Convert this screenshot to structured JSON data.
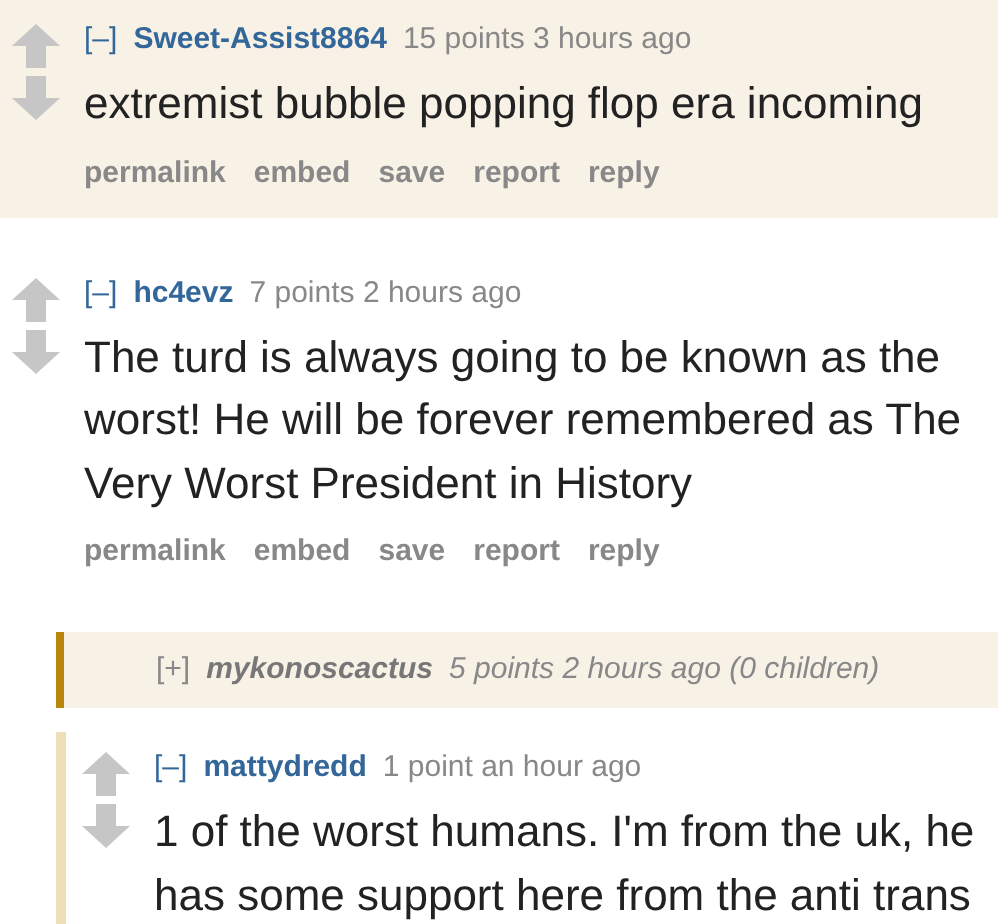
{
  "comments": [
    {
      "kind": "comment",
      "highlighted": true,
      "toggle": "[–]",
      "author": "Sweet-Assist8864",
      "tagline": "15 points 3 hours ago",
      "body": "extremist bubble popping flop era incoming",
      "actions": [
        "permalink",
        "embed",
        "save",
        "report",
        "reply"
      ]
    },
    {
      "kind": "comment",
      "highlighted": false,
      "toggle": "[–]",
      "author": "hc4evz",
      "tagline": "7 points 2 hours ago",
      "body": "The turd is always going to be known as the worst! He will be forever remembered as The Very Worst President in History",
      "actions": [
        "permalink",
        "embed",
        "save",
        "report",
        "reply"
      ],
      "children": [
        {
          "kind": "collapsed",
          "toggle": "[+]",
          "author": "mykonoscactus",
          "tagline": "5 points 2 hours ago (0 children)"
        },
        {
          "kind": "comment",
          "highlighted": false,
          "toggle": "[–]",
          "author": "mattydredd",
          "tagline": "1 point an hour ago",
          "body": "1 of the worst humans. I'm from the uk, he has some support here from the anti trans"
        }
      ]
    }
  ]
}
